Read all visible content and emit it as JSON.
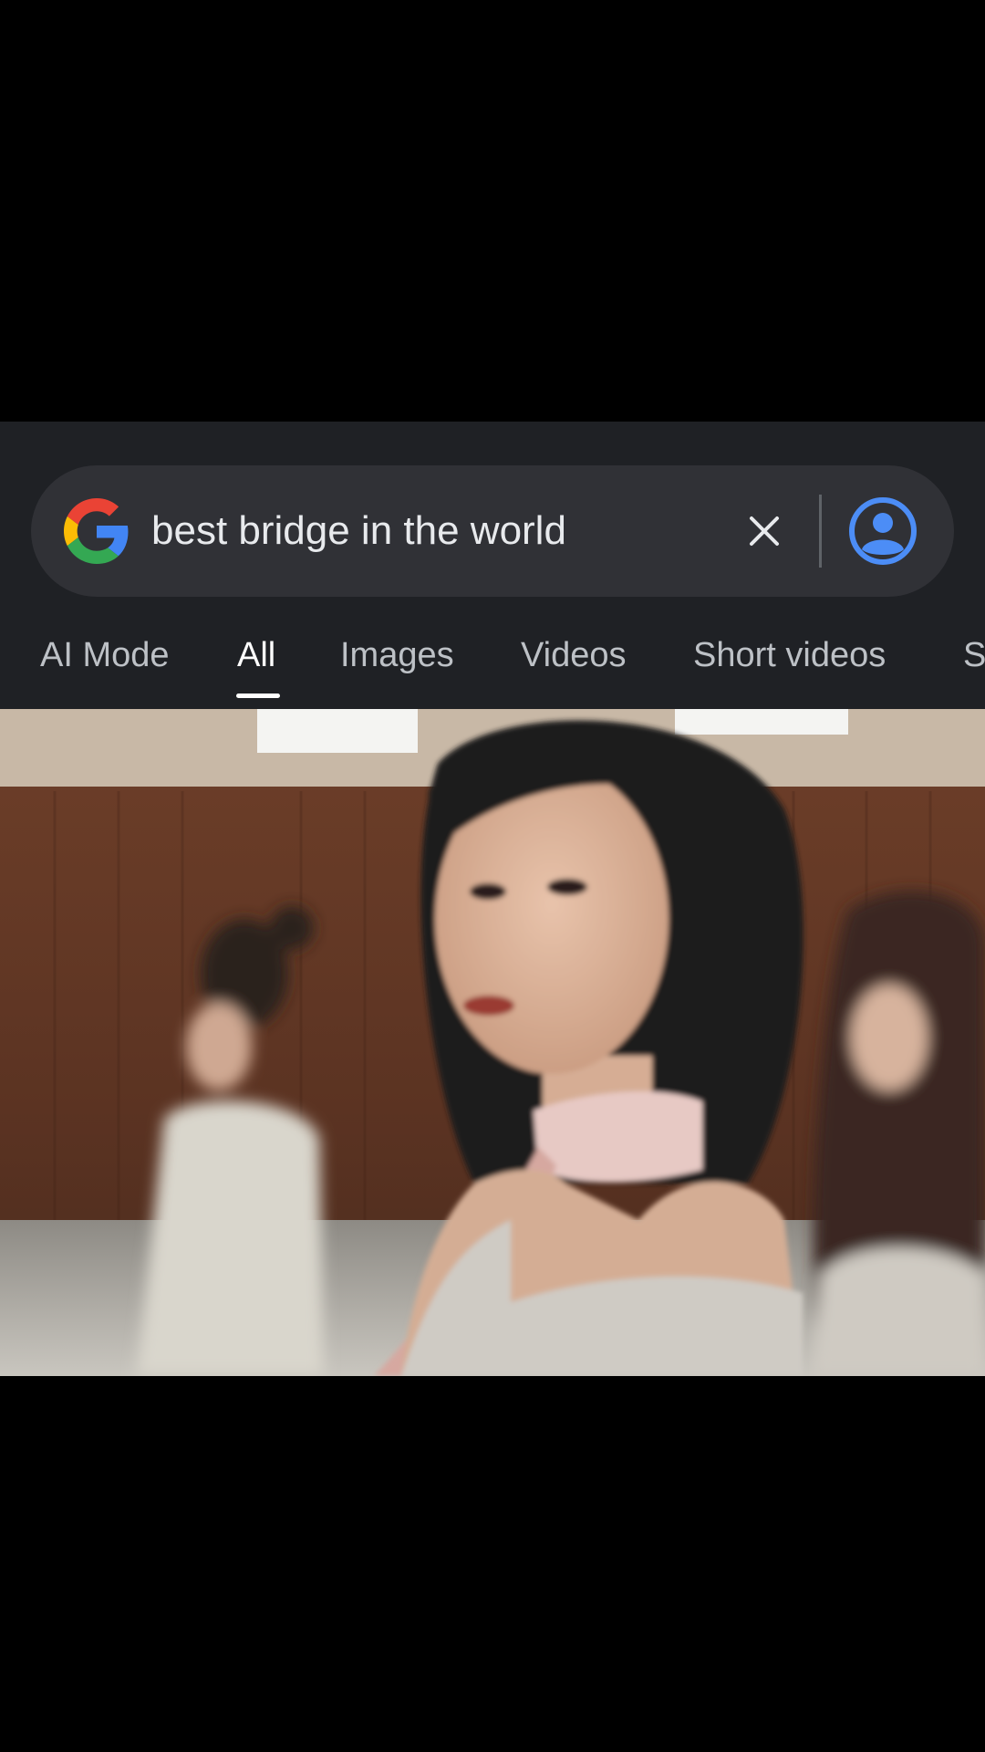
{
  "search": {
    "query": "best bridge in the world"
  },
  "tabs": [
    {
      "label": "AI Mode"
    },
    {
      "label": "All"
    },
    {
      "label": "Images"
    },
    {
      "label": "Videos"
    },
    {
      "label": "Short videos"
    },
    {
      "label": "S"
    }
  ],
  "active_tab": "All",
  "icons": {
    "logo": "google-g-logo",
    "clear": "close-icon",
    "account": "account-circle-icon"
  },
  "colors": {
    "background": "#000000",
    "panel": "#1f2125",
    "search_bar": "#303136",
    "text": "#e8eaed",
    "tab_text": "#bdc1c6",
    "avatar_blue": "#4c8df6"
  }
}
